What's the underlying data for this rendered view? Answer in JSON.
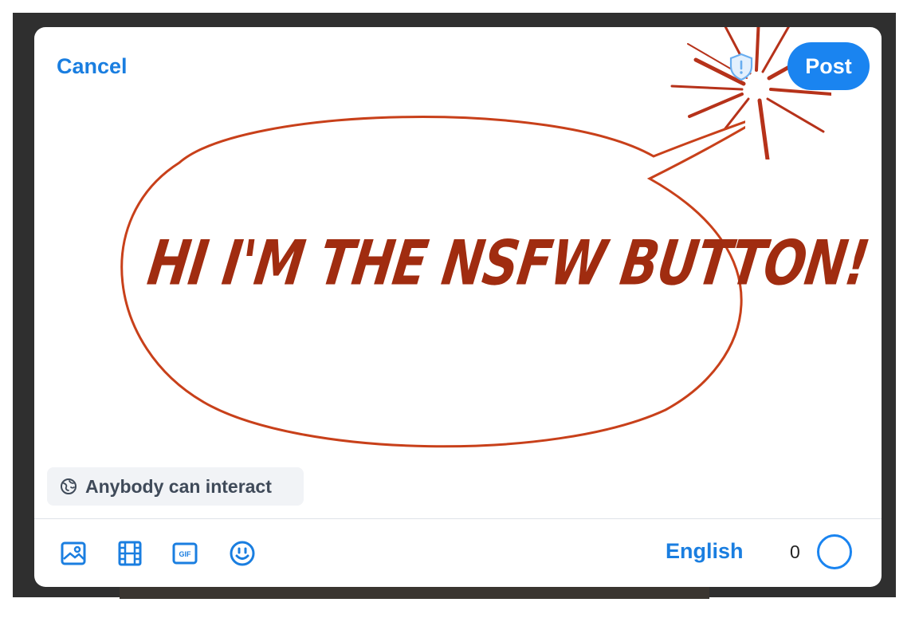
{
  "header": {
    "cancel_label": "Cancel",
    "post_label": "Post",
    "content_warning_icon": "shield-exclamation-icon"
  },
  "callout": {
    "text": "HI I'M THE NSFW BUTTON!"
  },
  "composer": {
    "interaction_setting": "Anybody can interact",
    "interaction_icon": "globe-icon"
  },
  "toolbar": {
    "tools": [
      {
        "name": "image-icon"
      },
      {
        "name": "video-icon"
      },
      {
        "name": "gif-icon"
      },
      {
        "name": "emoji-icon"
      }
    ],
    "language": "English",
    "char_count": "0"
  },
  "colors": {
    "accent": "#1a84f0",
    "callout_text": "#a02c10",
    "callout_outline": "#c8401a"
  }
}
